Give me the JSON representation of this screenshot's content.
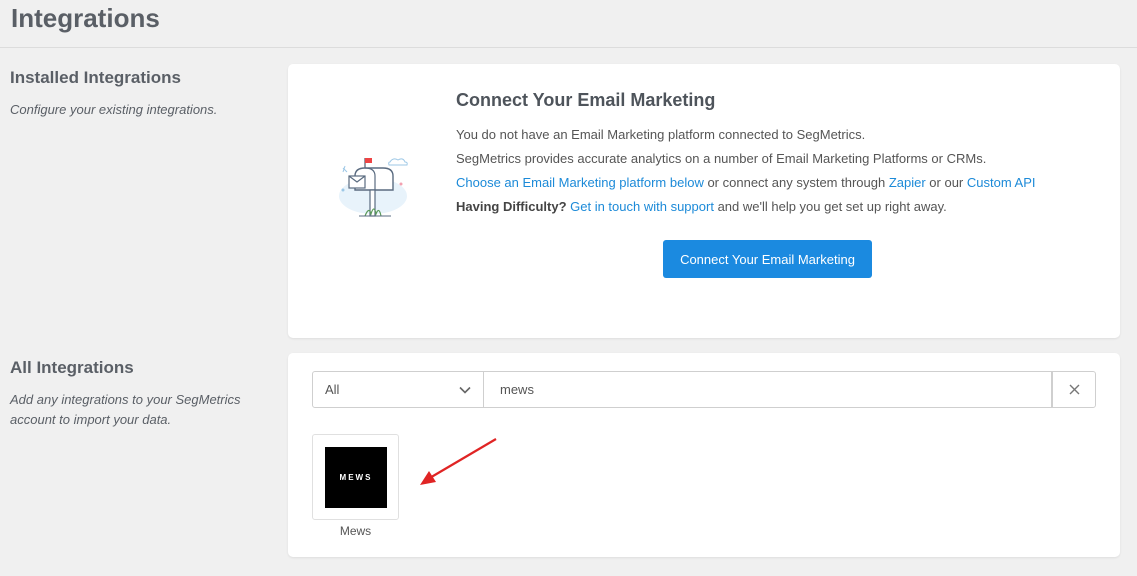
{
  "page": {
    "title": "Integrations"
  },
  "installed": {
    "title": "Installed Integrations",
    "description": "Configure your existing integrations.",
    "card": {
      "heading": "Connect Your Email Marketing",
      "line1": "You do not have an Email Marketing platform connected to SegMetrics.",
      "line2": "SegMetrics provides accurate analytics on a number of Email Marketing Platforms or CRMs.",
      "line3": {
        "link1": "Choose an Email Marketing platform below",
        "text1": " or connect any system through ",
        "link2": "Zapier",
        "text2": " or our ",
        "link3": "Custom API"
      },
      "line4": {
        "bold": "Having Difficulty?",
        "link": "Get in touch with support",
        "text": " and we'll help you get set up right away."
      },
      "button_label": "Connect Your Email Marketing",
      "illustration_icon": "mailbox-illustration"
    }
  },
  "all": {
    "title": "All Integrations",
    "description": "Add any integrations to your SegMetrics account to import your data.",
    "filter": {
      "selected": "All",
      "icon": "chevron-down-icon"
    },
    "search": {
      "value": "mews",
      "placeholder": ""
    },
    "clear_icon": "close-icon",
    "results": [
      {
        "name": "Mews",
        "logo_text": "MEWS"
      }
    ]
  },
  "colors": {
    "accent": "#1b8ae0",
    "link": "#1c8ad8",
    "annotation_arrow": "#e02424",
    "background": "#f0f0f0"
  }
}
